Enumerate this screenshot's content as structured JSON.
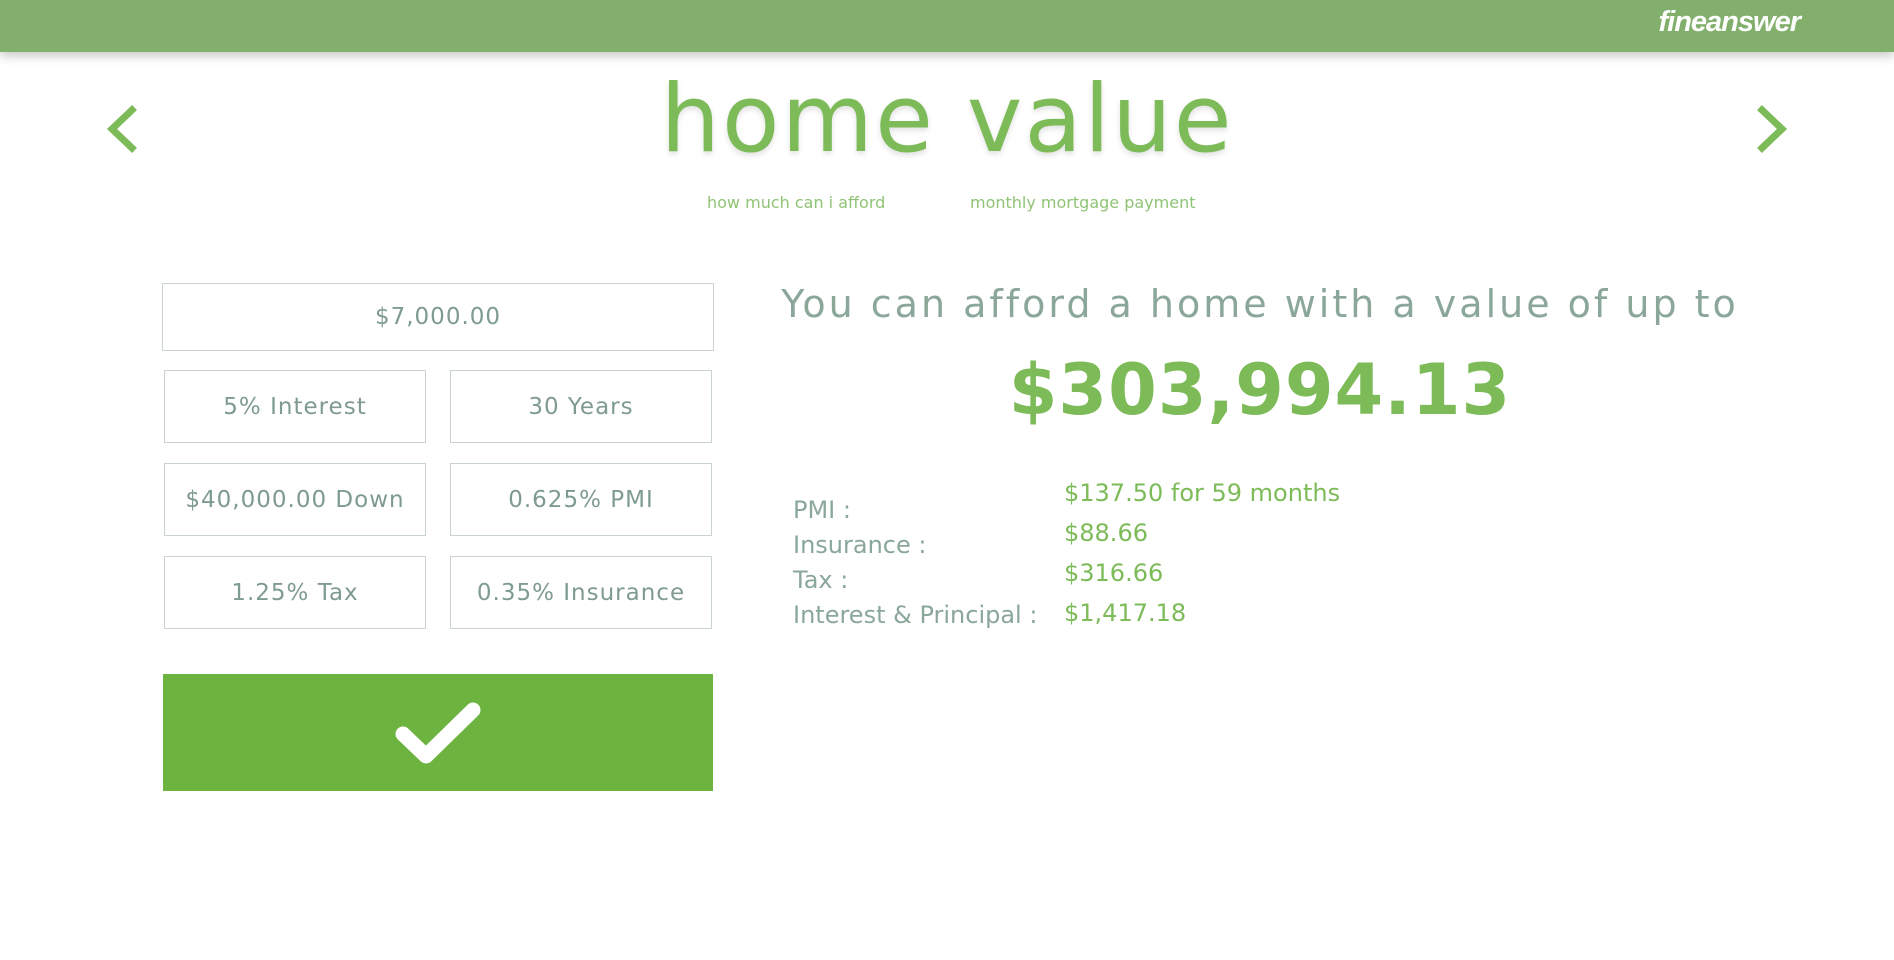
{
  "header": {
    "brand": "fineanswer",
    "accent_color": "#82b06c"
  },
  "navigation": {
    "prev_icon": "chevron-left-icon",
    "next_icon": "chevron-right-icon"
  },
  "page": {
    "title": "home value",
    "subnav": [
      {
        "label": "how much can i afford"
      },
      {
        "label": "monthly mortgage payment"
      }
    ]
  },
  "form": {
    "income": "$7,000.00",
    "interest": "5% Interest",
    "term": "30 Years",
    "down_payment": "$40,000.00 Down",
    "pmi": "0.625% PMI",
    "tax": "1.25% Tax",
    "insurance": "0.35% Insurance",
    "submit_icon": "checkmark-icon",
    "submit_color": "#6db33f"
  },
  "result": {
    "heading": "You can afford a home with a value of up to",
    "amount": "$303,994.13",
    "breakdown": [
      {
        "label": "PMI :",
        "value": "$137.50 for 59 months"
      },
      {
        "label": "Insurance :",
        "value": "$88.66"
      },
      {
        "label": "Tax :",
        "value": "$316.66"
      },
      {
        "label": "Interest & Principal :",
        "value": "$1,417.18"
      }
    ]
  }
}
